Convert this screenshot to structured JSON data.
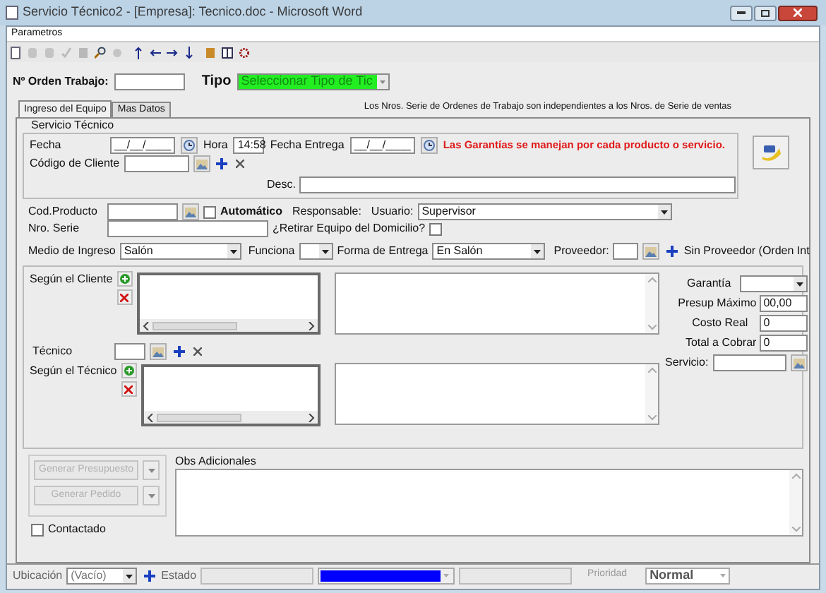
{
  "window": {
    "title": "Servicio Técnico2 - [Empresa]: Tecnico.doc - Microsoft Word"
  },
  "menu": [
    {
      "label": "Parametros"
    }
  ],
  "orden": {
    "label": "Nº Orden Trabajo:"
  },
  "tipo": {
    "label": "Tipo",
    "value": "Seleccionar Tipo de Tic"
  },
  "tabs": [
    {
      "label": "Ingreso del Equipo",
      "selected": true
    },
    {
      "label": "Mas Datos",
      "selected": false
    }
  ],
  "note": "Los Nros. Serie de Ordenes de Trabajo son independientes a los Nros. de Serie de ventas",
  "group_title": "Servicio Técnico",
  "fecha": {
    "label": "Fecha",
    "value": "__/__/____"
  },
  "hora": {
    "label": "Hora",
    "value": "14:58"
  },
  "fecha_entrega": {
    "label": "Fecha Entrega",
    "value": "__/__/____"
  },
  "warning": "Las Garantías se manejan por cada producto o servicio.",
  "codigo_cliente": {
    "label": "Código de Cliente"
  },
  "desc": {
    "label": "Desc."
  },
  "cod_producto": {
    "label": "Cod.Producto"
  },
  "automatico": {
    "label": "Automático",
    "checked": false
  },
  "responsable": {
    "label": "Responsable:"
  },
  "usuario": {
    "label": "Usuario:",
    "value": "Supervisor"
  },
  "nro_serie": {
    "label": "Nro. Serie"
  },
  "retirar": {
    "label": "¿Retirar Equipo del Domicilio?",
    "checked": false
  },
  "medio_ingreso": {
    "label": "Medio de Ingreso",
    "value": "Salón"
  },
  "funciona": {
    "label": "Funciona"
  },
  "forma_entrega": {
    "label": "Forma de Entrega",
    "value": "En Salón"
  },
  "proveedor": {
    "label": "Proveedor:",
    "sin_proveedor": "Sin Proveedor (Orden Int"
  },
  "segun_cliente": {
    "label": "Según el Cliente"
  },
  "tecnico": {
    "label": "Técnico"
  },
  "segun_tecnico": {
    "label": "Según el Técnico"
  },
  "garantia": {
    "label": "Garantía"
  },
  "presup_maximo": {
    "label": "Presup Máximo",
    "value": "00,00"
  },
  "costo_real": {
    "label": "Costo Real",
    "value": "0"
  },
  "total_cobrar": {
    "label": "Total a Cobrar",
    "value": "0"
  },
  "servicio": {
    "label": "Servicio:"
  },
  "actions": [
    {
      "label": "Generar Presupuesto",
      "disabled": true
    },
    {
      "label": "Generar Pedido",
      "disabled": true
    }
  ],
  "contactado": {
    "label": "Contactado",
    "checked": false
  },
  "obs": {
    "label": "Obs Adicionales"
  },
  "status_bar": {
    "ubicacion_label": "Ubicación",
    "ubicacion_value": "(Vacío)",
    "estado_label": "Estado",
    "color": "#0000ff",
    "prioridad_label": "Prioridad",
    "prioridad_disabled": true,
    "prioridad_value": "Normal"
  }
}
